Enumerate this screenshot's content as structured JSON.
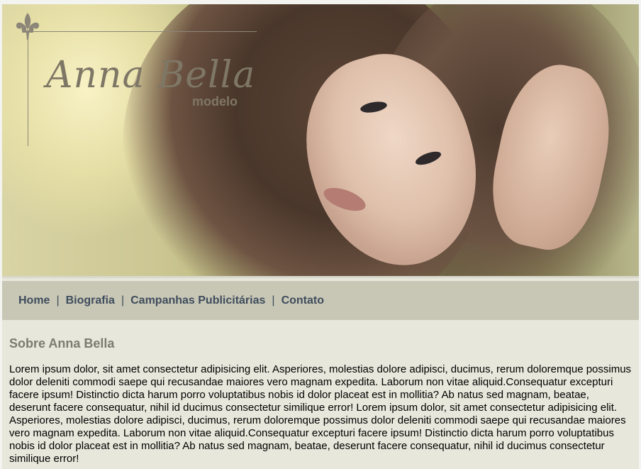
{
  "brand": {
    "name": "Anna Bella",
    "subtitle": "modelo"
  },
  "nav": {
    "items": [
      {
        "label": "Home"
      },
      {
        "label": "Biografia"
      },
      {
        "label": "Campanhas Publicitárias"
      },
      {
        "label": "Contato"
      }
    ],
    "separator": "|"
  },
  "hero": {
    "image": "portrait-photo"
  },
  "content": {
    "heading": "Sobre Anna Bella",
    "body": "Lorem ipsum dolor, sit amet consectetur adipisicing elit. Asperiores, molestias dolore adipisci, ducimus, rerum doloremque possimus dolor deleniti commodi saepe qui recusandae maiores vero magnam expedita. Laborum non vitae aliquid.Consequatur excepturi facere ipsum! Distinctio dicta harum porro voluptatibus nobis id dolor placeat est in mollitia? Ab natus sed magnam, beatae, deserunt facere consequatur, nihil id ducimus consectetur similique error! Lorem ipsum dolor, sit amet consectetur adipisicing elit. Asperiores, molestias dolore adipisci, ducimus, rerum doloremque possimus dolor deleniti commodi saepe qui recusandae maiores vero magnam expedita. Laborum non vitae aliquid.Consequatur excepturi facere ipsum! Distinctio dicta harum porro voluptatibus nobis id dolor placeat est in mollitia? Ab natus sed magnam, beatae, deserunt facere consequatur, nihil id ducimus consectetur similique error!"
  },
  "colors": {
    "nav_bg": "#c8c7b6",
    "content_bg": "#e7e7db",
    "link": "#3f4c5c",
    "heading": "#7b7b6e",
    "brand": "#7f7766"
  }
}
